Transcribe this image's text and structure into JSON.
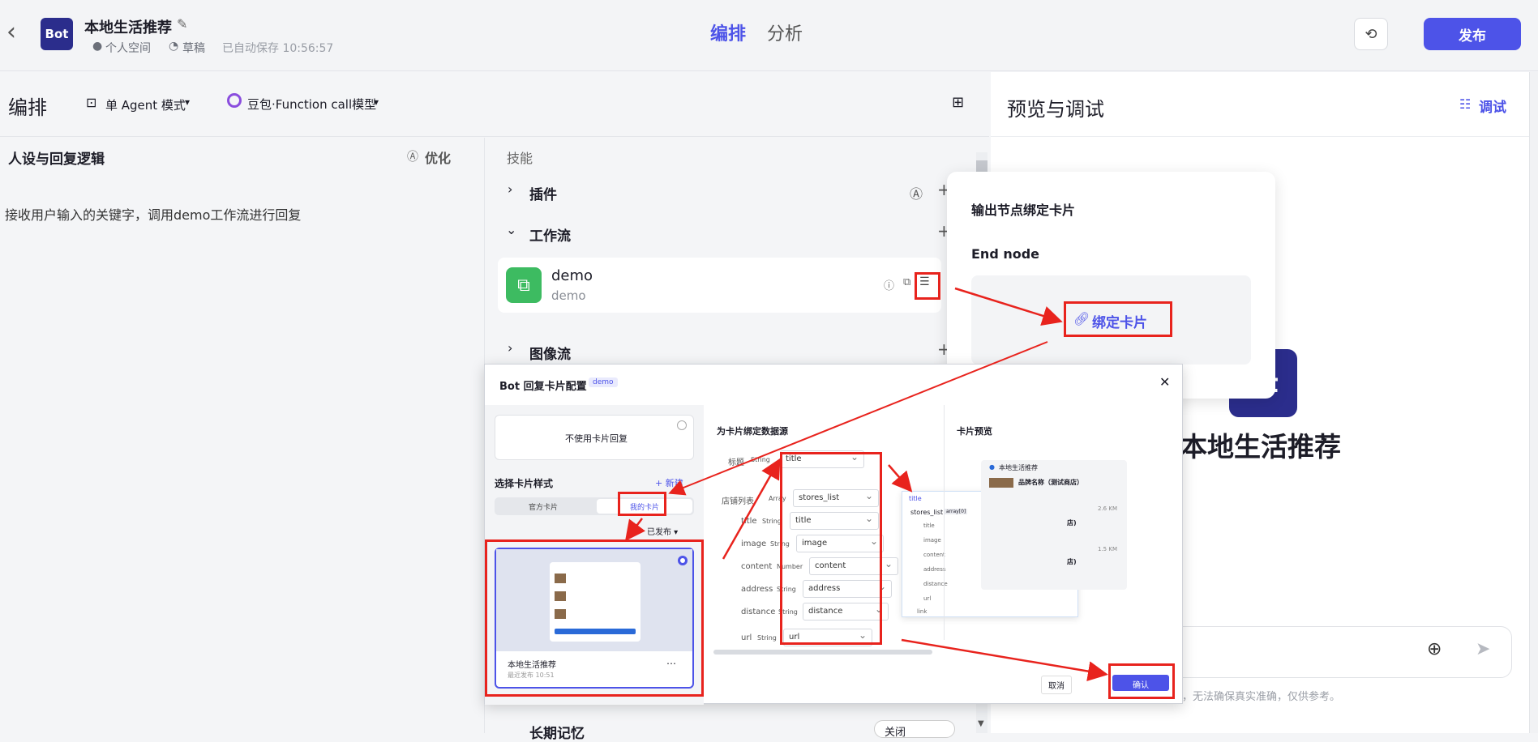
{
  "header": {
    "back": "‹",
    "logo_text": "Bot",
    "bot_name": "本地生活推荐",
    "space": "个人空间",
    "status": "草稿",
    "autosave": "已自动保存 10:56:57",
    "tabs": [
      "编排",
      "分析"
    ],
    "publish": "发布"
  },
  "toolbar": {
    "title": "编排",
    "mode": "单 Agent 模式",
    "model": "豆包·Function call模型"
  },
  "persona": {
    "title": "人设与回复逻辑",
    "optimize": "优化",
    "content": "接收用户输入的关键字，调用demo工作流进行回复"
  },
  "skills": {
    "title": "技能",
    "plugin": "插件",
    "workflow": "工作流",
    "workflow_item": {
      "name": "demo",
      "desc": "demo"
    },
    "imageflow": "图像流",
    "memory": "长期记忆",
    "memory_value": "关闭"
  },
  "preview": {
    "title": "预览与调试",
    "debug": "调试",
    "bot_big_name": "本地生活推荐",
    "bot_logo_partial": "ot",
    "disclaimer": "生成，无法确保真实准确，仅供参考。"
  },
  "card_popup": {
    "title": "输出节点绑定卡片",
    "node": "End node",
    "bind": "绑定卡片"
  },
  "dialog": {
    "title": "Bot 回复卡片配置",
    "tag": "demo",
    "no_card": "不使用卡片回复",
    "choose_style": "选择卡片样式",
    "new": "+ 新建",
    "tab_official": "官方卡片",
    "tab_mine": "我的卡片",
    "published": "已发布 ▾",
    "card_name": "本地生活推荐",
    "card_time": "最近发布 10:51",
    "bind_source": "为卡片绑定数据源",
    "preview_title": "卡片预览",
    "cancel": "取消",
    "confirm": "确认",
    "fields": [
      {
        "label": "标题",
        "type": "String",
        "value": "title"
      },
      {
        "label": "店铺列表",
        "type": "Array",
        "value": "stores_list"
      },
      {
        "label": "title",
        "type": "String",
        "value": "title"
      },
      {
        "label": "image",
        "type": "String",
        "value": "image"
      },
      {
        "label": "content",
        "type": "Number",
        "value": "content"
      },
      {
        "label": "address",
        "type": "String",
        "value": "address"
      },
      {
        "label": "distance",
        "type": "String",
        "value": "distance"
      },
      {
        "label": "url",
        "type": "String",
        "value": "url"
      }
    ],
    "dropdown": [
      "title",
      "stores_list",
      "title",
      "image",
      "content",
      "address",
      "distance",
      "url",
      "link"
    ],
    "dropdown_tag": "array[0]",
    "preview_header": "本地生活推荐",
    "preview_item": "品牌名称（测试商店）",
    "preview_dist1": "2.6 KM",
    "preview_dist2": "1.5 KM",
    "preview_suffix1": "店)",
    "preview_suffix2": "店)"
  }
}
